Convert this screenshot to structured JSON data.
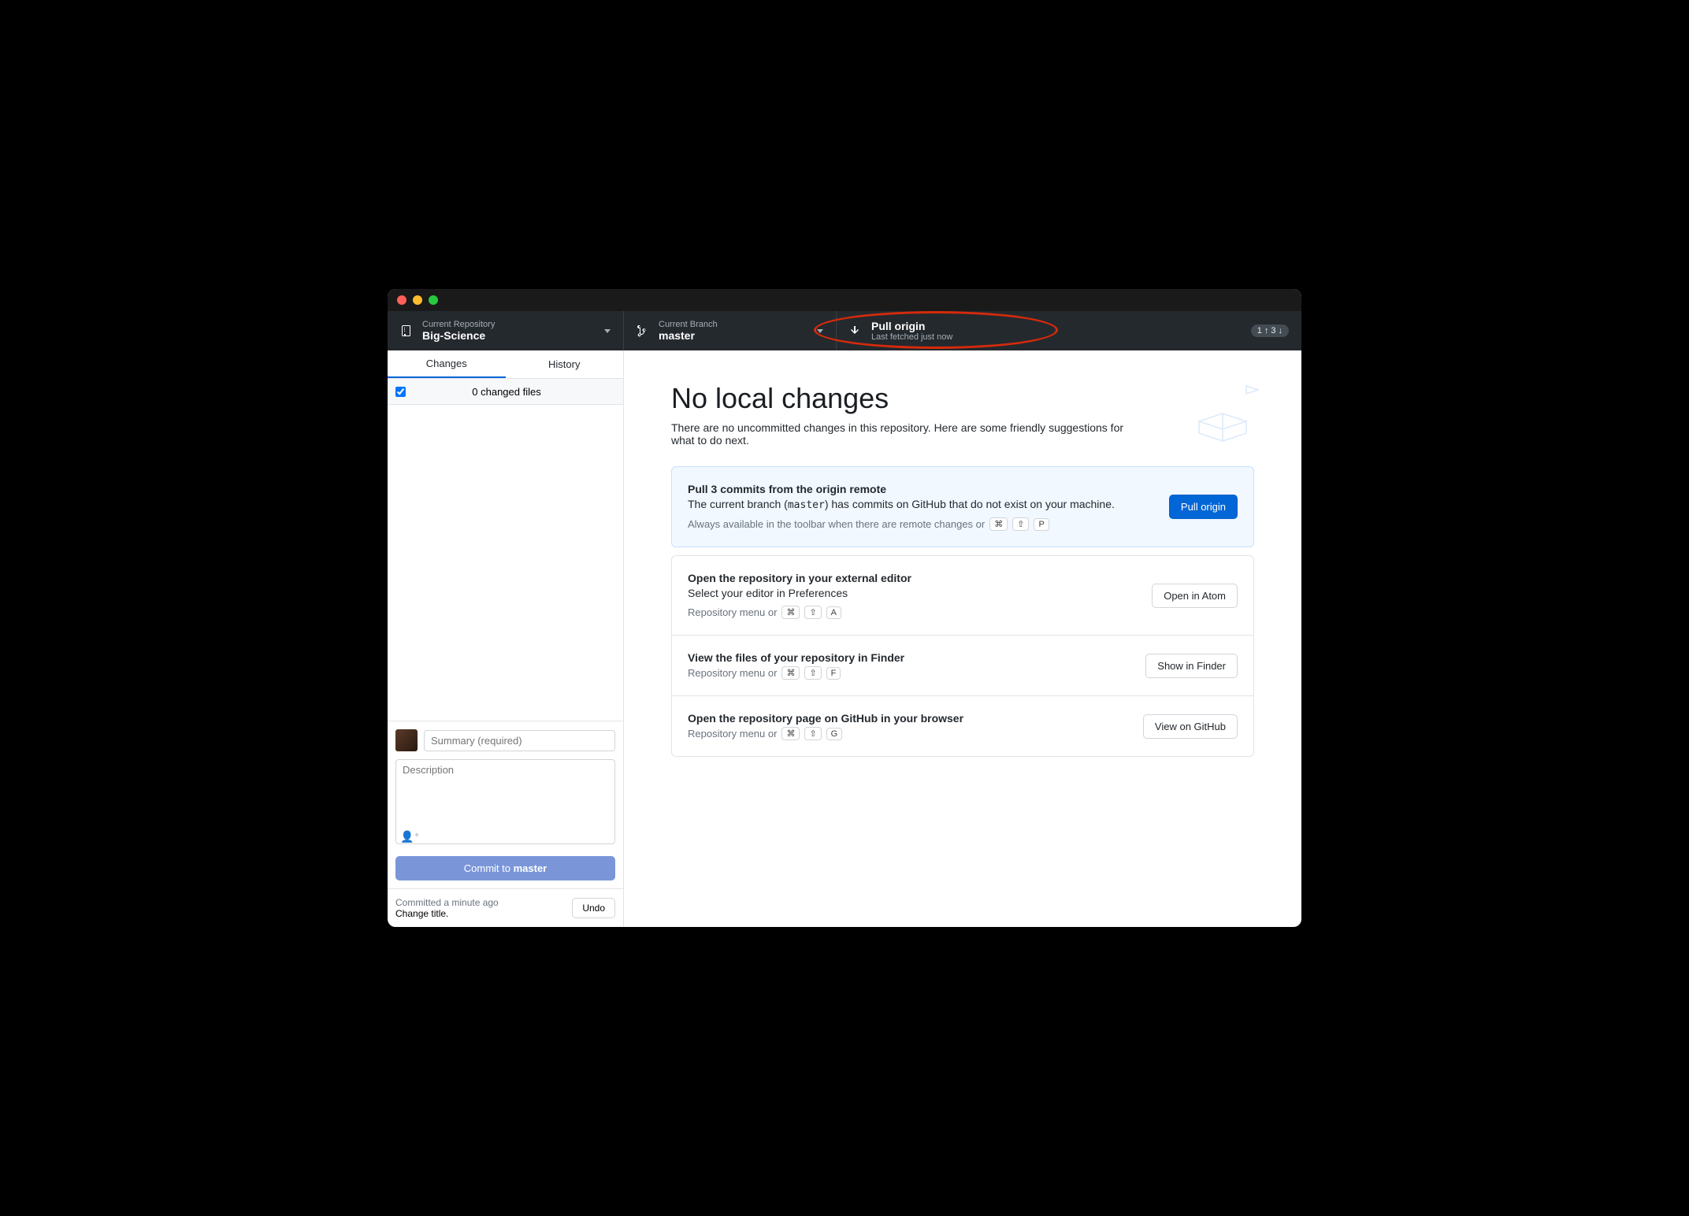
{
  "toolbar": {
    "repo": {
      "label": "Current Repository",
      "value": "Big-Science"
    },
    "branch": {
      "label": "Current Branch",
      "value": "master"
    },
    "pull": {
      "label": "Pull origin",
      "sub": "Last fetched just now",
      "badge_up": "1",
      "badge_down": "3"
    }
  },
  "sidebar": {
    "tabs": {
      "changes": "Changes",
      "history": "History"
    },
    "changed_files": "0 changed files",
    "summary_placeholder": "Summary (required)",
    "description_placeholder": "Description",
    "commit_prefix": "Commit to ",
    "commit_branch": "master",
    "undo": {
      "meta": "Committed a minute ago",
      "msg": "Change title.",
      "button": "Undo"
    }
  },
  "main": {
    "title": "No local changes",
    "subtitle": "There are no uncommitted changes in this repository. Here are some friendly suggestions for what to do next.",
    "pull_card": {
      "title": "Pull 3 commits from the origin remote",
      "desc_pre": "The current branch (",
      "desc_branch": "master",
      "desc_post": ") has commits on GitHub that do not exist on your machine.",
      "hint": "Always available in the toolbar when there are remote changes or",
      "keys": [
        "⌘",
        "⇧",
        "P"
      ],
      "button": "Pull origin"
    },
    "editor_card": {
      "title": "Open the repository in your external editor",
      "desc_pre": "Select your editor in ",
      "desc_link": "Preferences",
      "hint": "Repository menu or",
      "keys": [
        "⌘",
        "⇧",
        "A"
      ],
      "button": "Open in Atom"
    },
    "finder_card": {
      "title": "View the files of your repository in Finder",
      "hint": "Repository menu or",
      "keys": [
        "⌘",
        "⇧",
        "F"
      ],
      "button": "Show in Finder"
    },
    "github_card": {
      "title": "Open the repository page on GitHub in your browser",
      "hint": "Repository menu or",
      "keys": [
        "⌘",
        "⇧",
        "G"
      ],
      "button": "View on GitHub"
    }
  }
}
